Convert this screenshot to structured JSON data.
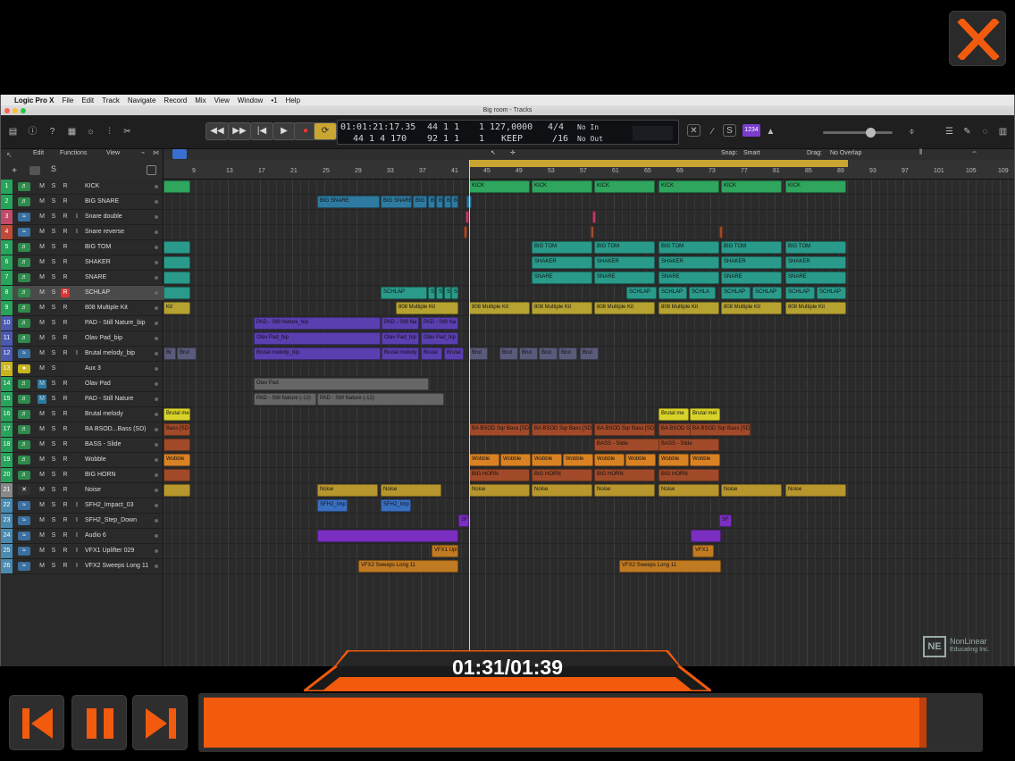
{
  "menubar": {
    "apple": "",
    "app": "Logic Pro X",
    "items": [
      "File",
      "Edit",
      "Track",
      "Navigate",
      "Record",
      "Mix",
      "View",
      "Window",
      "•1",
      "Help"
    ]
  },
  "window": {
    "title": "Big room - Tracks"
  },
  "lcd": {
    "time": "01:01:21:17.35",
    "bars": "44  1  1",
    "beat": "1",
    "tempo": "127,0000",
    "sig": "4/4",
    "in": "No In",
    "time2": "44  1  4  170",
    "bars2": "92  1  1",
    "beat2": "1",
    "keep": "KEEP",
    "div": "/16",
    "out": "No Out"
  },
  "toolbar": {
    "edit": "Edit",
    "functions": "Functions",
    "view": "View",
    "snap_label": "Snap:",
    "snap": "Smart",
    "drag_label": "Drag:",
    "drag": "No Overlap",
    "count": "1234"
  },
  "ruler": {
    "marks": [
      "9",
      "13",
      "17",
      "21",
      "25",
      "29",
      "33",
      "37",
      "41",
      "45",
      "49",
      "53",
      "57",
      "61",
      "65",
      "69",
      "73",
      "77",
      "81",
      "85",
      "89",
      "93",
      "97",
      "101",
      "105",
      "109"
    ]
  },
  "tracks": [
    {
      "n": "1",
      "name": "KICK",
      "color": "#27a35a",
      "type": "inst"
    },
    {
      "n": "2",
      "name": "BIG SNARE",
      "color": "#27a35a",
      "type": "inst"
    },
    {
      "n": "3",
      "name": "Snare double",
      "color": "#c04a6a",
      "type": "audio"
    },
    {
      "n": "4",
      "name": "Snare reverse",
      "color": "#c04a3a",
      "type": "audio"
    },
    {
      "n": "5",
      "name": "BIG TOM",
      "color": "#27a35a",
      "type": "inst"
    },
    {
      "n": "6",
      "name": "SHAKER",
      "color": "#27a35a",
      "type": "inst"
    },
    {
      "n": "7",
      "name": "SNARE",
      "color": "#27a35a",
      "type": "inst"
    },
    {
      "n": "8",
      "name": "SCHLAP",
      "color": "#27a35a",
      "type": "inst"
    },
    {
      "n": "9",
      "name": "808 Multiple Kit",
      "color": "#27a35a",
      "type": "inst"
    },
    {
      "n": "10",
      "name": "PAD - Still Nature_bip",
      "color": "#4a5ab0",
      "type": "inst"
    },
    {
      "n": "11",
      "name": "Olav Pad_bip",
      "color": "#4a5ab0",
      "type": "inst"
    },
    {
      "n": "12",
      "name": "Brutal melody_bip",
      "color": "#4a5ab0",
      "type": "audio"
    },
    {
      "n": "13",
      "name": "Aux 3",
      "color": "#c9b420",
      "type": "aux"
    },
    {
      "n": "14",
      "name": "Olav Pad",
      "color": "#27a35a",
      "type": "inst"
    },
    {
      "n": "15",
      "name": "PAD - Still Nature",
      "color": "#27a35a",
      "type": "inst"
    },
    {
      "n": "16",
      "name": "Brutal melody",
      "color": "#27a35a",
      "type": "inst"
    },
    {
      "n": "17",
      "name": "BA BSOD...Bass (SD)",
      "color": "#27a35a",
      "type": "inst"
    },
    {
      "n": "18",
      "name": "BASS - Slide",
      "color": "#27a35a",
      "type": "inst"
    },
    {
      "n": "19",
      "name": "Wobble",
      "color": "#27a35a",
      "type": "inst"
    },
    {
      "n": "20",
      "name": "BIG HORN",
      "color": "#27a35a",
      "type": "inst"
    },
    {
      "n": "21",
      "name": "Noise",
      "color": "#888",
      "type": "off"
    },
    {
      "n": "22",
      "name": "SFH2_Impact_03",
      "color": "#4a8ab0",
      "type": "audio"
    },
    {
      "n": "23",
      "name": "SFH2_Step_Down",
      "color": "#4a8ab0",
      "type": "audio"
    },
    {
      "n": "24",
      "name": "Audio 6",
      "color": "#4a8ab0",
      "type": "audio"
    },
    {
      "n": "25",
      "name": "VFX1 Uplifter 029",
      "color": "#4a8ab0",
      "type": "audio"
    },
    {
      "n": "26",
      "name": "VFX2 Sweeps Long 11",
      "color": "#4a8ab0",
      "type": "audio"
    }
  ],
  "regions": {
    "kick": "KICK",
    "big_snare": "BIG SNARE",
    "big": "BIG",
    "b": "B",
    "big_tom": "BIG TOM",
    "shaker": "SHAKER",
    "snare": "SNARE",
    "schlap": "SCHLAP",
    "schla": "SCHLA",
    "s": "S",
    "kit": "808 Multiple Kit",
    "kit_short": "Kit",
    "pad_bip": "PAD - Still Nature_bip",
    "pad_bip2": "PAD - Still Na",
    "pad_bip3": "PAD - Still Na",
    "olav_bip": "Olav Pad_bip",
    "brutal_bip": "Brutal melody_bip",
    "brutal_bip2": "Brutal melody",
    "brutal": "Brutal",
    "brut": "Brut",
    "brutl": "Brutl",
    "bru": "Br",
    "olav_pad": "Olav Pad",
    "pad_still": "PAD - Still Nature (-12)",
    "pad_still2": "PAD - Still Nature (-12)",
    "brutal_mel": "Brutal mel",
    "brutal_mel2": "Brutal me",
    "brutal_mel3": "Brutal mel",
    "bass_sd": "BA BSOD Sqr Bass [SD",
    "bass_sd_short": "Bass [SD",
    "bass_slide": "BASS - Slide",
    "wobble": "Wobble",
    "horn": "BIG HORN",
    "noise": "Noise",
    "sfh2": "SFH2_Imp",
    "sf": "SF",
    "vfx1": "VFX1 Uplit",
    "vfx1b": "VFX1",
    "vfx2": "VFX2 Sweeps Long 11"
  },
  "watermark": {
    "line1": "NonLinear",
    "line2": "Educating Inc.",
    "logo": "NE"
  },
  "player": {
    "time": "01:31/01:39",
    "progress": 0.93
  },
  "colors": {
    "accent": "#f25a0e",
    "green": "#27a35a",
    "yellow": "#b5a230",
    "orange": "#d98224",
    "purple": "#7a2fc0"
  }
}
